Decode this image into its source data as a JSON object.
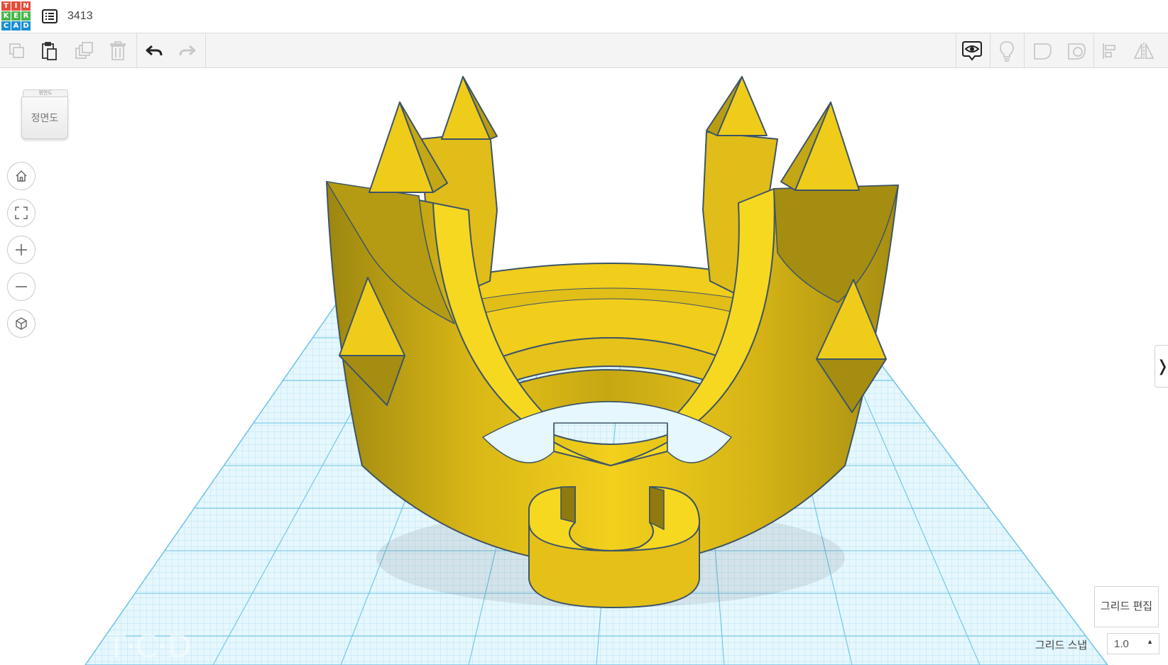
{
  "app": {
    "logo_letters": [
      "T",
      "I",
      "N",
      "K",
      "E",
      "R",
      "C",
      "A",
      "D"
    ],
    "logo_colors": [
      "#e24e3c",
      "#e24e3c",
      "#e24e3c",
      "#49b64a",
      "#49b64a",
      "#49b64a",
      "#1a8fd3",
      "#1a8fd3",
      "#1a8fd3"
    ],
    "design_title": "3413"
  },
  "toolbar": {
    "left": [
      {
        "id": "copy",
        "icon": "copy-icon",
        "enabled": false
      },
      {
        "id": "paste",
        "icon": "paste-icon",
        "enabled": true
      },
      {
        "id": "duplicate",
        "icon": "duplicate-icon",
        "enabled": false
      },
      {
        "id": "delete",
        "icon": "trash-icon",
        "enabled": false
      },
      {
        "id": "undo",
        "icon": "undo-icon",
        "enabled": true
      },
      {
        "id": "redo",
        "icon": "redo-icon",
        "enabled": false
      }
    ],
    "right": [
      {
        "id": "notes",
        "icon": "eye-bubble-icon",
        "enabled": true
      },
      {
        "id": "light",
        "icon": "lightbulb-icon",
        "enabled": false
      },
      {
        "id": "solid",
        "icon": "solid-shape-icon",
        "enabled": false
      },
      {
        "id": "hole",
        "icon": "hole-shape-icon",
        "enabled": false
      },
      {
        "id": "align",
        "icon": "align-icon",
        "enabled": false
      },
      {
        "id": "mirror",
        "icon": "mirror-icon",
        "enabled": false
      }
    ]
  },
  "view_cube": {
    "top_label": "평면도",
    "front_label": "정면도"
  },
  "navigation": [
    {
      "id": "home",
      "icon": "home-icon"
    },
    {
      "id": "fit",
      "icon": "fit-view-icon"
    },
    {
      "id": "zoom_in",
      "icon": "zoom-in-icon"
    },
    {
      "id": "zoom_out",
      "icon": "zoom-out-icon"
    },
    {
      "id": "perspective",
      "icon": "perspective-cube-icon"
    }
  ],
  "colors": {
    "shape": "#f0cc1a",
    "outline": "#3d5566",
    "grid_minor": "#a9dff2",
    "grid_major": "#6fc3e6",
    "grid_fill": "#e6f7fd"
  },
  "grid_controls": {
    "edit_grid_label": "그리드 편집",
    "snap_label": "그리드 스냅",
    "snap_value": "1.0"
  }
}
